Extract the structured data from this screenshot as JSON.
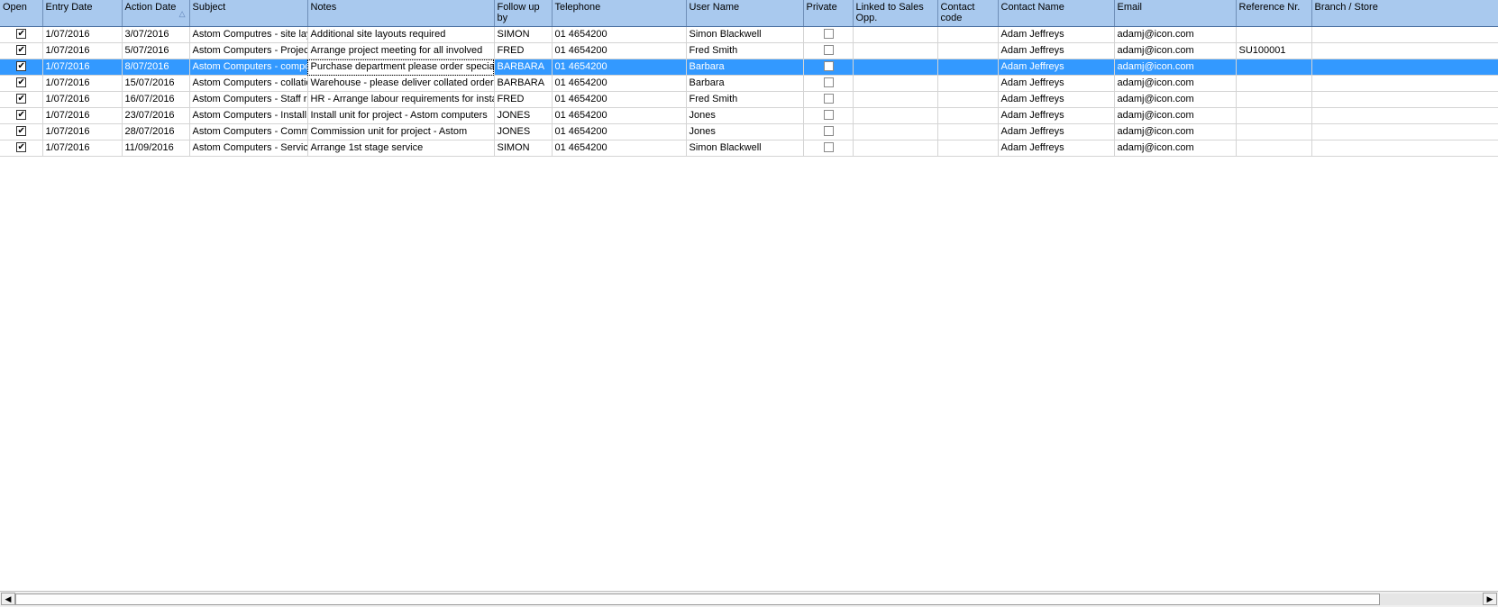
{
  "columns": [
    {
      "label": "Open"
    },
    {
      "label": "Entry Date"
    },
    {
      "label": "Action Date"
    },
    {
      "label": "Subject"
    },
    {
      "label": "Notes"
    },
    {
      "label": "Follow up by"
    },
    {
      "label": "Telephone"
    },
    {
      "label": "User Name"
    },
    {
      "label": "Private"
    },
    {
      "label": "Linked to Sales Opp."
    },
    {
      "label": "Contact code"
    },
    {
      "label": "Contact Name"
    },
    {
      "label": "Email"
    },
    {
      "label": "Reference Nr."
    },
    {
      "label": "Branch / Store"
    }
  ],
  "sort": {
    "column": "Action Date",
    "direction": "ascending",
    "icon": "sort-ascending-icon"
  },
  "rows": [
    {
      "open": true,
      "entry_date": "1/07/2016",
      "action_date": "3/07/2016",
      "subject": "Astom Computres - site layout",
      "notes": "Additional site layouts required",
      "follow_up_by": "SIMON",
      "telephone": "01 4654200",
      "user_name": "Simon Blackwell",
      "private": false,
      "linked_sales_opp": "",
      "contact_code": "",
      "contact_name": "Adam Jeffreys",
      "email": "adamj@icon.com",
      "reference_nr": "",
      "branch_store": "",
      "selected": false
    },
    {
      "open": true,
      "entry_date": "1/07/2016",
      "action_date": "5/07/2016",
      "subject": "Astom Computers - Project",
      "notes": "Arrange project meeting for all involved",
      "follow_up_by": "FRED",
      "telephone": "01 4654200",
      "user_name": "Fred Smith",
      "private": false,
      "linked_sales_opp": "",
      "contact_code": "",
      "contact_name": "Adam Jeffreys",
      "email": "adamj@icon.com",
      "reference_nr": "SU100001",
      "branch_store": "",
      "selected": false
    },
    {
      "open": true,
      "entry_date": "1/07/2016",
      "action_date": "8/07/2016",
      "subject": "Astom Computers - components",
      "notes": "Purchase department please order special",
      "follow_up_by": "BARBARA",
      "telephone": "01 4654200",
      "user_name": "Barbara",
      "private": false,
      "linked_sales_opp": "",
      "contact_code": "",
      "contact_name": "Adam Jeffreys",
      "email": "adamj@icon.com",
      "reference_nr": "",
      "branch_store": "",
      "selected": true
    },
    {
      "open": true,
      "entry_date": "1/07/2016",
      "action_date": "15/07/2016",
      "subject": "Astom Computers - collation",
      "notes": "Warehouse - please deliver collated orders",
      "follow_up_by": "BARBARA",
      "telephone": "01 4654200",
      "user_name": "Barbara",
      "private": false,
      "linked_sales_opp": "",
      "contact_code": "",
      "contact_name": "Adam Jeffreys",
      "email": "adamj@icon.com",
      "reference_nr": "",
      "branch_store": "",
      "selected": false
    },
    {
      "open": true,
      "entry_date": "1/07/2016",
      "action_date": "16/07/2016",
      "subject": "Astom Computers - Staff requirements",
      "notes": "HR - Arrange labour requirements for install",
      "follow_up_by": "FRED",
      "telephone": "01 4654200",
      "user_name": "Fred Smith",
      "private": false,
      "linked_sales_opp": "",
      "contact_code": "",
      "contact_name": "Adam Jeffreys",
      "email": "adamj@icon.com",
      "reference_nr": "",
      "branch_store": "",
      "selected": false
    },
    {
      "open": true,
      "entry_date": "1/07/2016",
      "action_date": "23/07/2016",
      "subject": "Astom Computers - Install",
      "notes": "Install unit for project - Astom computers",
      "follow_up_by": "JONES",
      "telephone": "01 4654200",
      "user_name": "Jones",
      "private": false,
      "linked_sales_opp": "",
      "contact_code": "",
      "contact_name": "Adam Jeffreys",
      "email": "adamj@icon.com",
      "reference_nr": "",
      "branch_store": "",
      "selected": false
    },
    {
      "open": true,
      "entry_date": "1/07/2016",
      "action_date": "28/07/2016",
      "subject": "Astom Computers - Commission",
      "notes": "Commission unit for project - Astom",
      "follow_up_by": "JONES",
      "telephone": "01 4654200",
      "user_name": "Jones",
      "private": false,
      "linked_sales_opp": "",
      "contact_code": "",
      "contact_name": "Adam Jeffreys",
      "email": "adamj@icon.com",
      "reference_nr": "",
      "branch_store": "",
      "selected": false
    },
    {
      "open": true,
      "entry_date": "1/07/2016",
      "action_date": "11/09/2016",
      "subject": "Astom Computers - Service",
      "notes": "Arrange 1st stage service",
      "follow_up_by": "SIMON",
      "telephone": "01 4654200",
      "user_name": "Simon Blackwell",
      "private": false,
      "linked_sales_opp": "",
      "contact_code": "",
      "contact_name": "Adam Jeffreys",
      "email": "adamj@icon.com",
      "reference_nr": "",
      "branch_store": "",
      "selected": false
    }
  ],
  "colors": {
    "header_bg": "#a9c9ee",
    "selection": "#3399ff",
    "gridline": "#d4d4d4"
  },
  "scrollbar": {
    "left_icon": "scroll-left-icon",
    "right_icon": "scroll-right-icon",
    "thumb_fraction": 0.93
  }
}
